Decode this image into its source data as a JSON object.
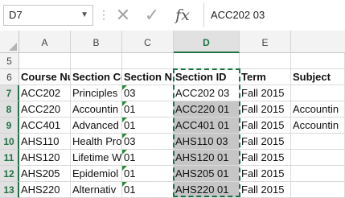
{
  "formula_bar": {
    "name_box": "D7",
    "formula_value": "ACC202 03",
    "icons": [
      "cancel-icon",
      "enter-icon",
      "fx-icon"
    ]
  },
  "grid": {
    "columns": [
      "A",
      "B",
      "C",
      "D",
      "E"
    ],
    "selected_column": "D",
    "rows": [
      {
        "num": "5",
        "cells": [
          "",
          "",
          "",
          "",
          ""
        ]
      },
      {
        "num": "6",
        "cells": [
          "Course Nu",
          "Section Co",
          "Section N",
          "Section ID",
          "Term",
          "Subject"
        ]
      },
      {
        "num": "7",
        "cells": [
          "ACC202",
          "Principles",
          "03",
          "ACC202 03",
          "Fall 2015",
          ""
        ]
      },
      {
        "num": "8",
        "cells": [
          "ACC220",
          "Accountin",
          "01",
          "ACC220 01",
          "Fall 2015",
          "Accountin"
        ]
      },
      {
        "num": "9",
        "cells": [
          "ACC401",
          "Advanced",
          "01",
          "ACC401 01",
          "Fall 2015",
          "Accountin"
        ]
      },
      {
        "num": "10",
        "cells": [
          "AHS110",
          "Health Pro",
          "03",
          "AHS110 03",
          "Fall 2015",
          ""
        ]
      },
      {
        "num": "11",
        "cells": [
          "AHS120",
          "Lifetime W",
          "01",
          "AHS120 01",
          "Fall 2015",
          ""
        ]
      },
      {
        "num": "12",
        "cells": [
          "AHS205",
          "Epidemiol",
          "01",
          "AHS205 01",
          "Fall 2015",
          ""
        ]
      },
      {
        "num": "13",
        "cells": [
          "AHS220",
          "Alternativ",
          "01",
          "AHS220 01",
          "Fall 2015",
          ""
        ]
      }
    ]
  },
  "colors": {
    "accent": "#217346",
    "selection_fill": "#c6c6c6",
    "error_triangle": "#2e8b3e"
  }
}
